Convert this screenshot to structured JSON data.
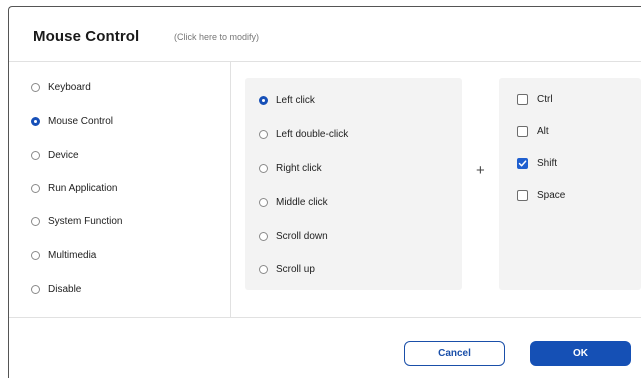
{
  "dialog": {
    "title": "Mouse Control",
    "hint": "(Click here to modify)"
  },
  "categories": [
    {
      "label": "Keyboard",
      "selected": false
    },
    {
      "label": "Mouse Control",
      "selected": true
    },
    {
      "label": "Device",
      "selected": false
    },
    {
      "label": "Run Application",
      "selected": false
    },
    {
      "label": "System Function",
      "selected": false
    },
    {
      "label": "Multimedia",
      "selected": false
    },
    {
      "label": "Disable",
      "selected": false
    }
  ],
  "mouse_actions": [
    {
      "label": "Left click",
      "selected": true
    },
    {
      "label": "Left double-click",
      "selected": false
    },
    {
      "label": "Right click",
      "selected": false
    },
    {
      "label": "Middle click",
      "selected": false
    },
    {
      "label": "Scroll down",
      "selected": false
    },
    {
      "label": "Scroll up",
      "selected": false
    }
  ],
  "combiner_symbol": "+",
  "modifiers": [
    {
      "label": "Ctrl",
      "checked": false
    },
    {
      "label": "Alt",
      "checked": false
    },
    {
      "label": "Shift",
      "checked": true
    },
    {
      "label": "Space",
      "checked": false
    }
  ],
  "buttons": {
    "cancel_label": "Cancel",
    "ok_label": "OK"
  },
  "colors": {
    "accent": "#1550b5",
    "panel_background": "#f3f3f3"
  }
}
